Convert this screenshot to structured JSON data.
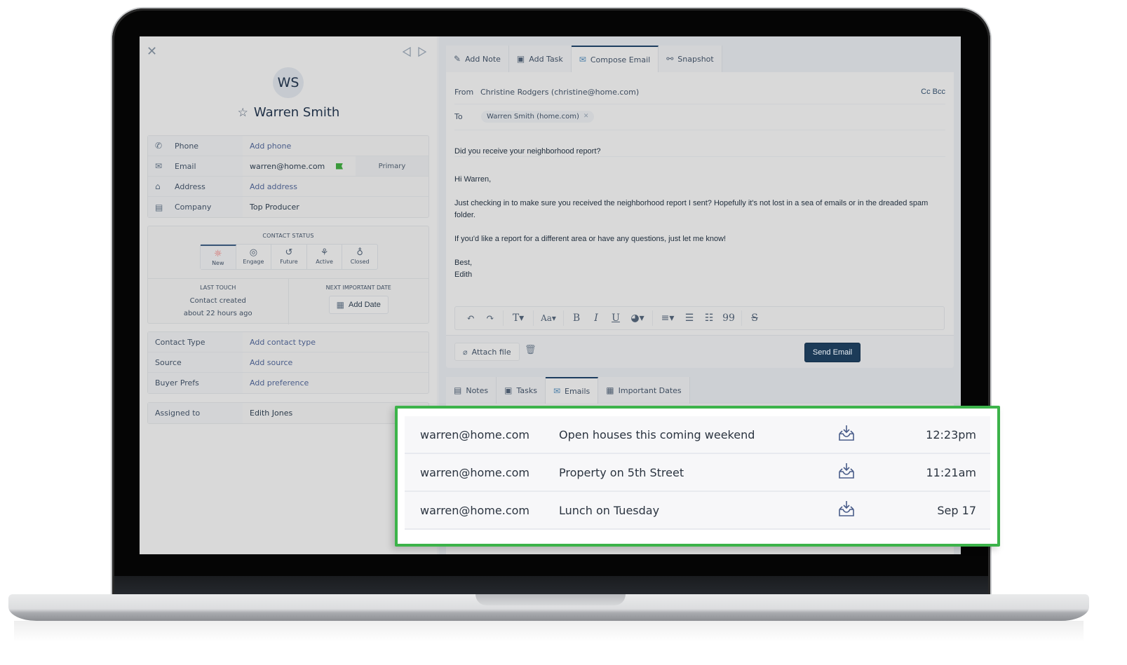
{
  "contact": {
    "initials": "WS",
    "name": "Warren Smith",
    "info_rows": [
      {
        "icon": "phone-icon",
        "glyph": "✆",
        "label": "Phone",
        "value": "Add phone",
        "is_link": true
      },
      {
        "icon": "email-icon",
        "glyph": "✉",
        "label": "Email",
        "value": "warren@home.com",
        "is_link": false,
        "tag": "Primary"
      },
      {
        "icon": "home-icon",
        "glyph": "⌂",
        "label": "Address",
        "value": "Add address",
        "is_link": true
      },
      {
        "icon": "company-icon",
        "glyph": "▤",
        "label": "Company",
        "value": "Top Producer",
        "is_link": false
      }
    ],
    "status": {
      "title": "CONTACT STATUS",
      "options": [
        {
          "label": "New",
          "glyph": "☼",
          "active": true
        },
        {
          "label": "Engage",
          "glyph": "◎",
          "active": false
        },
        {
          "label": "Future",
          "glyph": "↺",
          "active": false
        },
        {
          "label": "Active",
          "glyph": "⚘",
          "active": false
        },
        {
          "label": "Closed",
          "glyph": "♁",
          "active": false
        }
      ],
      "last_touch_title": "LAST TOUCH",
      "last_touch_line1": "Contact created",
      "last_touch_line2": "about 22 hours ago",
      "next_date_title": "NEXT IMPORTANT DATE",
      "add_date_label": "Add Date"
    },
    "details_rows": [
      {
        "label": "Contact Type",
        "value": "Add contact type"
      },
      {
        "label": "Source",
        "value": "Add source"
      },
      {
        "label": "Buyer Prefs",
        "value": "Add preference"
      }
    ],
    "assigned": {
      "label": "Assigned to",
      "value": "Edith Jones"
    }
  },
  "compose": {
    "tabs": [
      {
        "label": "Add Note",
        "icon": "edit-note-icon",
        "glyph": "✎",
        "active": false
      },
      {
        "label": "Add Task",
        "icon": "clipboard-icon",
        "glyph": "▣",
        "active": false
      },
      {
        "label": "Compose Email",
        "icon": "envelope-icon",
        "glyph": "✉",
        "active": true
      },
      {
        "label": "Snapshot",
        "icon": "snapshot-icon",
        "glyph": "⚯",
        "active": false
      }
    ],
    "from_label": "From",
    "from_value": "Christine Rodgers (christine@home.com)",
    "cc_bcc": "Cc Bcc",
    "to_label": "To",
    "to_chip": "Warren Smith (home.com)",
    "subject": "Did you receive your neighborhood report?",
    "body": [
      "Hi Warren,",
      "Just checking in to make sure you received the neighborhood report I sent? Hopefully it's not lost in a sea of emails or in the dreaded spam folder.",
      "If you'd like a report for a different area or have any questions, just let me know!",
      "Best,",
      "Edith"
    ],
    "attach_label": "Attach file",
    "send_label": "Send Email"
  },
  "history": {
    "tabs": [
      {
        "label": "Notes",
        "icon": "notes-icon",
        "glyph": "▤",
        "active": false
      },
      {
        "label": "Tasks",
        "icon": "tasks-icon",
        "glyph": "▣",
        "active": false
      },
      {
        "label": "Emails",
        "icon": "envelope-icon",
        "glyph": "✉",
        "active": true
      },
      {
        "label": "Important Dates",
        "icon": "calendar-star-icon",
        "glyph": "▦",
        "active": false
      }
    ],
    "emails": [
      {
        "from": "warren@home.com",
        "subject": "Open houses this coming weekend",
        "time": "12:23pm"
      },
      {
        "from": "warren@home.com",
        "subject": "Property on 5th Street",
        "time": "11:21am"
      },
      {
        "from": "warren@home.com",
        "subject": "Lunch on Tuesday",
        "time": "Sep 17"
      }
    ]
  },
  "colors": {
    "accent_navy": "#1c3b58",
    "highlight_green": "#3cb34a",
    "flag_green": "#3a9a3a",
    "new_status_red": "#d9534f"
  }
}
